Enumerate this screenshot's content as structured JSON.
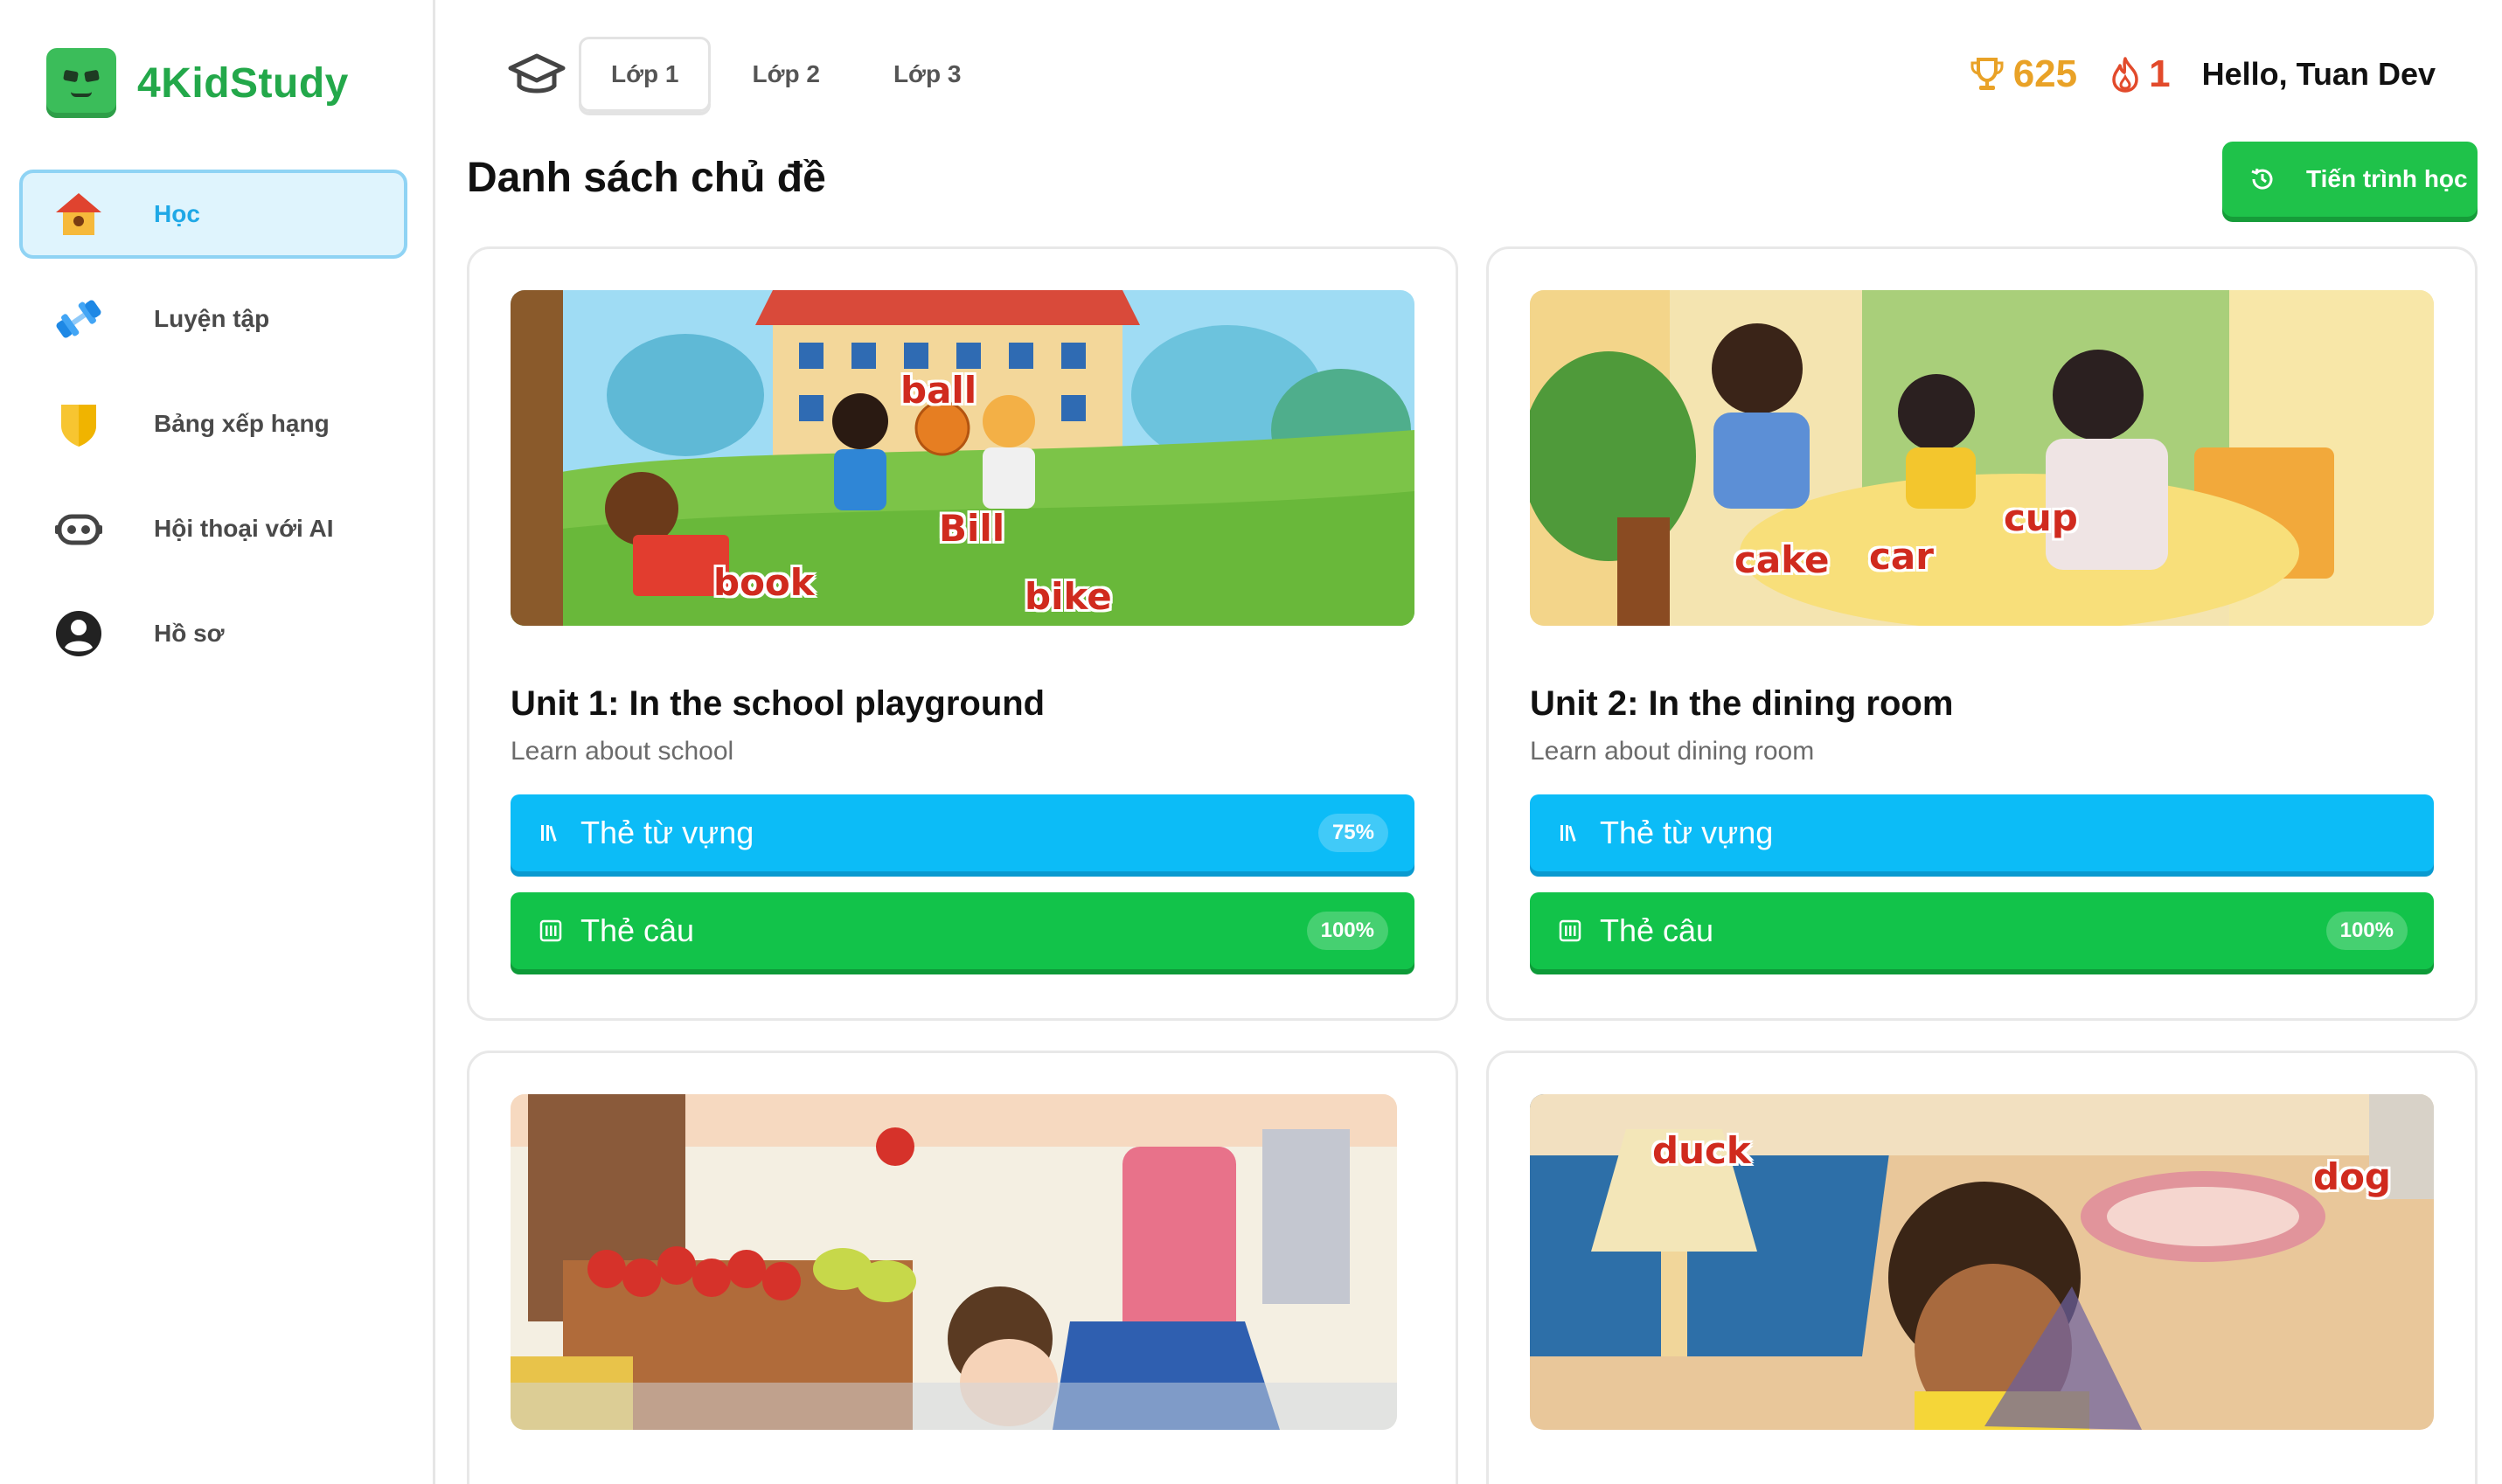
{
  "brand": {
    "name": "4KidStudy"
  },
  "sidebar": {
    "items": [
      {
        "label": "Học",
        "icon": "home-icon",
        "active": true
      },
      {
        "label": "Luyện tập",
        "icon": "dumbbell-icon",
        "active": false
      },
      {
        "label": "Bảng xếp hạng",
        "icon": "shield-icon",
        "active": false
      },
      {
        "label": "Hội thoại với AI",
        "icon": "robot-icon",
        "active": false
      },
      {
        "label": "Hồ sơ",
        "icon": "user-icon",
        "active": false
      }
    ]
  },
  "header": {
    "tabs": [
      {
        "label": "Lớp 1",
        "active": true
      },
      {
        "label": "Lớp 2",
        "active": false
      },
      {
        "label": "Lớp 3",
        "active": false
      }
    ],
    "points": "625",
    "streak": "1",
    "greeting": "Hello, Tuan Dev"
  },
  "main": {
    "title": "Danh sách chủ đề",
    "progress_button": "Tiến trình học",
    "units": [
      {
        "title": "Unit 1: In the school playground",
        "subtitle": "Learn about school",
        "vocab_label": "Thẻ từ vựng",
        "vocab_progress": "75%",
        "sentence_label": "Thẻ câu",
        "sentence_progress": "100%",
        "image_words": [
          "ball",
          "Bill",
          "book",
          "bike"
        ]
      },
      {
        "title": "Unit 2: In the dining room",
        "subtitle": "Learn about dining room",
        "vocab_label": "Thẻ từ vựng",
        "vocab_progress": "",
        "sentence_label": "Thẻ câu",
        "sentence_progress": "100%",
        "image_words": [
          "cup",
          "cake",
          "car"
        ]
      },
      {
        "image_words": []
      },
      {
        "image_words": [
          "duck",
          "dog"
        ]
      }
    ]
  },
  "colors": {
    "brand_green": "#23a84a",
    "active_blue": "#1fa8e6",
    "vocab_blue": "#0cbcf7",
    "sentence_green": "#12c34a",
    "trophy_gold": "#e9a227",
    "fire_red": "#e24a2b"
  }
}
